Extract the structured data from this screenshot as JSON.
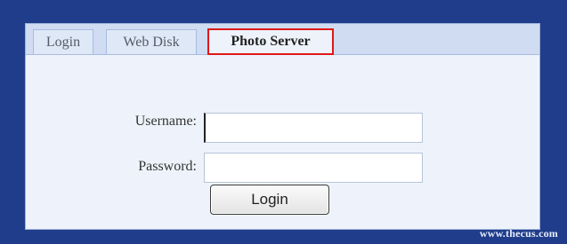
{
  "tabs": [
    {
      "label": "Login"
    },
    {
      "label": "Web Disk"
    },
    {
      "label": "Photo Server"
    }
  ],
  "form": {
    "username_label": "Username:",
    "username_value": "",
    "password_label": "Password:",
    "password_value": "",
    "login_label": "Login"
  },
  "footer": {
    "website": "www.thecus.com"
  },
  "colors": {
    "frame": "#1f3d8a",
    "panel": "#eef3fb",
    "highlight": "#e01818"
  }
}
